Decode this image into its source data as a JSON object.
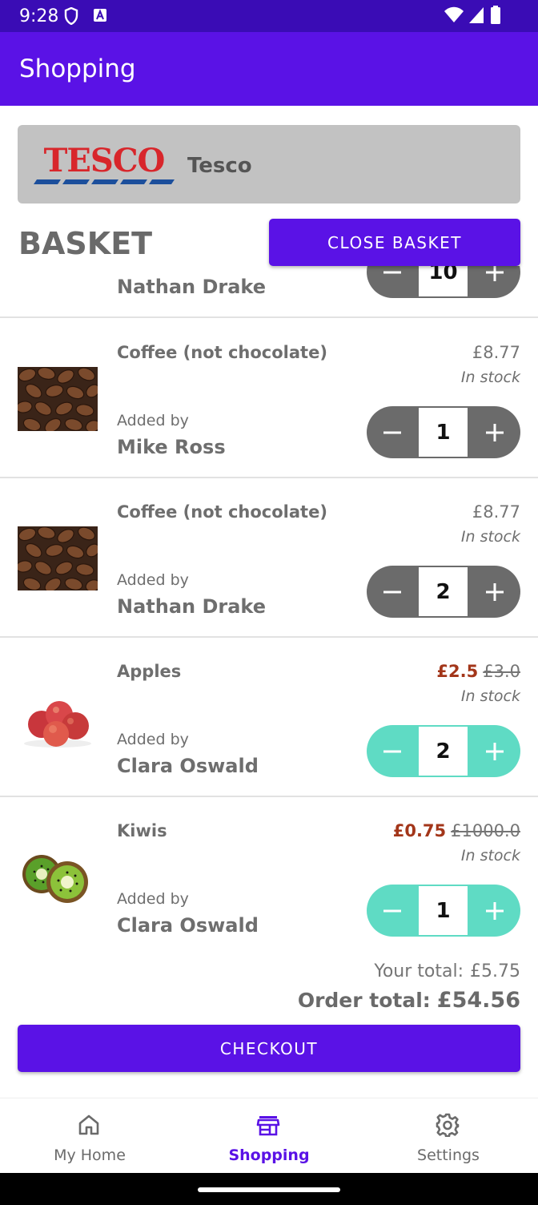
{
  "status_bar": {
    "time": "9:28"
  },
  "app_bar": {
    "title": "Shopping"
  },
  "store": {
    "name": "Tesco",
    "logo_text": "TESCO"
  },
  "basket": {
    "title": "BASKET",
    "close_label": "CLOSE BASKET",
    "partial_item": {
      "added_by_name": "Nathan Drake",
      "quantity": "10"
    },
    "items": [
      {
        "name": "Coffee (not chocolate)",
        "price": "£8.77",
        "old_price": "",
        "stock": "In stock",
        "added_by_label": "Added by",
        "added_by_name": "Mike Ross",
        "quantity": "1",
        "image": "coffee-beans",
        "stepper_color": "#6b6b6b"
      },
      {
        "name": "Coffee (not chocolate)",
        "price": "£8.77",
        "old_price": "",
        "stock": "In stock",
        "added_by_label": "Added by",
        "added_by_name": "Nathan Drake",
        "quantity": "2",
        "image": "coffee-beans",
        "stepper_color": "#6b6b6b"
      },
      {
        "name": "Apples",
        "price": "£2.5",
        "old_price": "£3.0",
        "stock": "In stock",
        "added_by_label": "Added by",
        "added_by_name": "Clara Oswald",
        "quantity": "2",
        "image": "apples",
        "stepper_color": "#5fdbc4"
      },
      {
        "name": "Kiwis",
        "price": "£0.75",
        "old_price": "£1000.0",
        "stock": "In stock",
        "added_by_label": "Added by",
        "added_by_name": "Clara Oswald",
        "quantity": "1",
        "image": "kiwis",
        "stepper_color": "#5fdbc4"
      }
    ]
  },
  "totals": {
    "your_total_label": "Your total:",
    "your_total_value": "£5.75",
    "order_total_label": "Order total:",
    "order_total_value": "£54.56"
  },
  "checkout_label": "CHECKOUT",
  "bottom_nav": {
    "items": [
      {
        "label": "My Home",
        "icon": "home-icon",
        "active": false
      },
      {
        "label": "Shopping",
        "icon": "store-icon",
        "active": true
      },
      {
        "label": "Settings",
        "icon": "gear-icon",
        "active": false
      }
    ]
  },
  "colors": {
    "primary": "#5a12e6",
    "status_bar": "#3a0cb5",
    "sale": "#a3361a",
    "teal_stepper": "#5fdbc4",
    "grey_stepper": "#6b6b6b"
  }
}
